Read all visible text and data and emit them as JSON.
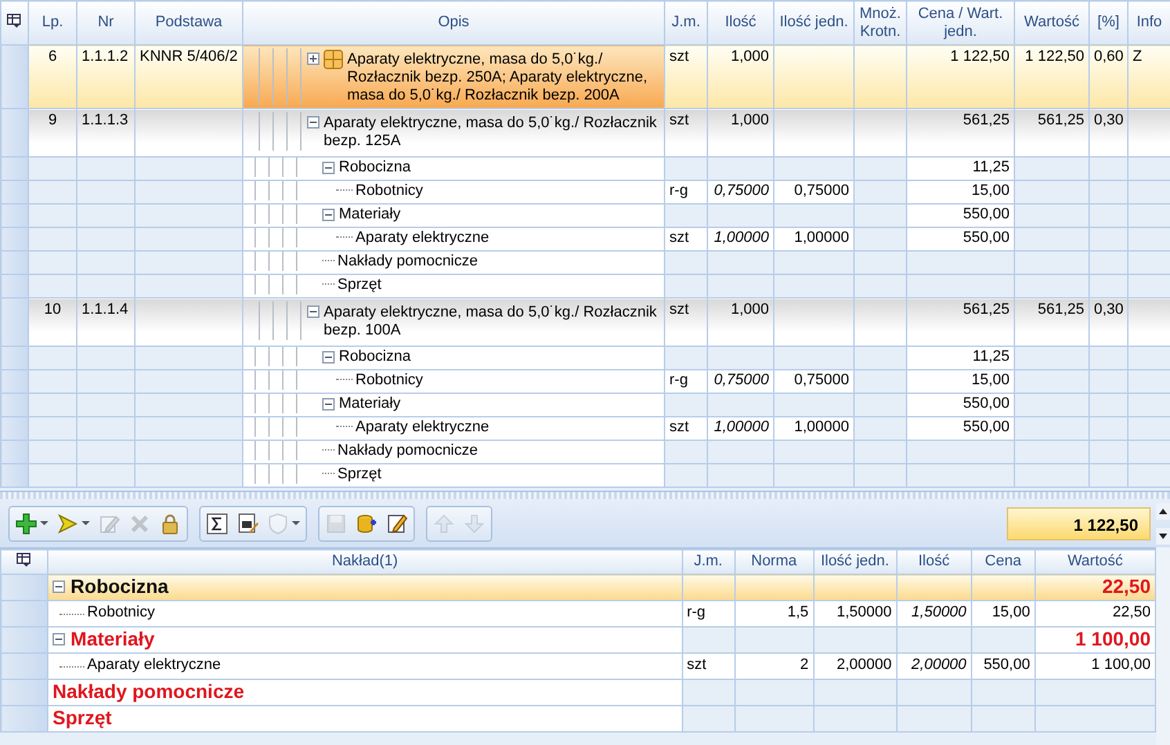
{
  "grid": {
    "columns": [
      "Lp.",
      "Nr",
      "Podstawa",
      "Opis",
      "J.m.",
      "Ilość",
      "Ilość jedn.",
      "Mnoż. Krotn.",
      "Cena / Wart. jedn.",
      "Wartość",
      "[%]",
      "Info"
    ],
    "rows": [
      {
        "kind": "position",
        "lp": "6",
        "nr": "1.1.1.2",
        "podstawa": "KNNR 5/406/2",
        "opis": "Aparaty elektryczne, masa do 5,0˙kg./ Rozłacznik bezp. 250A; Aparaty elektryczne, masa do 5,0˙kg./ Rozłacznik bezp. 200A",
        "jm": "szt",
        "ilosc": "1,000",
        "cena": "1 122,50",
        "wartosc": "1 122,50",
        "procent": "0,60",
        "info": "Z",
        "selected": true,
        "expanded": false,
        "grouped": true
      },
      {
        "kind": "position",
        "lp": "9",
        "nr": "1.1.1.3",
        "opis": "Aparaty elektryczne, masa do 5,0˙kg./ Rozłacznik bezp. 125A",
        "jm": "szt",
        "ilosc": "1,000",
        "cena": "561,25",
        "wartosc": "561,25",
        "procent": "0,30",
        "selected": false,
        "expanded": true,
        "grouped": false,
        "children": [
          {
            "kind": "group",
            "opis": "Robocizna",
            "cena": "11,25",
            "expanded": true,
            "children": [
              {
                "kind": "resource",
                "opis": "Robotnicy",
                "jm": "r-g",
                "ilosc": "0,75000",
                "ilosc_jedn": "0,75000",
                "cena": "15,00"
              }
            ]
          },
          {
            "kind": "group",
            "opis": "Materiały",
            "cena": "550,00",
            "expanded": true,
            "children": [
              {
                "kind": "resource",
                "opis": "Aparaty elektryczne",
                "jm": "szt",
                "ilosc": "1,00000",
                "ilosc_jedn": "1,00000",
                "cena": "550,00"
              }
            ]
          },
          {
            "kind": "empty-group",
            "opis": "Nakłady pomocnicze"
          },
          {
            "kind": "empty-group",
            "opis": "Sprzęt"
          }
        ]
      },
      {
        "kind": "position",
        "lp": "10",
        "nr": "1.1.1.4",
        "opis": "Aparaty elektryczne, masa do 5,0˙kg./ Rozłacznik bezp. 100A",
        "jm": "szt",
        "ilosc": "1,000",
        "cena": "561,25",
        "wartosc": "561,25",
        "procent": "0,30",
        "selected": false,
        "expanded": true,
        "grouped": false,
        "children": [
          {
            "kind": "group",
            "opis": "Robocizna",
            "cena": "11,25",
            "expanded": true,
            "children": [
              {
                "kind": "resource",
                "opis": "Robotnicy",
                "jm": "r-g",
                "ilosc": "0,75000",
                "ilosc_jedn": "0,75000",
                "cena": "15,00"
              }
            ]
          },
          {
            "kind": "group",
            "opis": "Materiały",
            "cena": "550,00",
            "expanded": true,
            "children": [
              {
                "kind": "resource",
                "opis": "Aparaty elektryczne",
                "jm": "szt",
                "ilosc": "1,00000",
                "ilosc_jedn": "1,00000",
                "cena": "550,00"
              }
            ]
          },
          {
            "kind": "empty-group",
            "opis": "Nakłady pomocnicze"
          },
          {
            "kind": "empty-group",
            "opis": "Sprzęt"
          }
        ]
      }
    ]
  },
  "toolbar": {
    "groups": [
      [
        {
          "dropdown": true,
          "disabled": false
        },
        {
          "dropdown": true,
          "disabled": false
        },
        {
          "dropdown": false,
          "disabled": true
        },
        {
          "dropdown": false,
          "disabled": true
        },
        {
          "dropdown": false,
          "disabled": false
        }
      ],
      [
        {
          "dropdown": false,
          "disabled": false
        },
        {
          "dropdown": false,
          "disabled": false
        },
        {
          "dropdown": true,
          "disabled": true
        }
      ],
      [
        {
          "dropdown": false,
          "disabled": true
        },
        {
          "dropdown": false,
          "disabled": false
        },
        {
          "dropdown": false,
          "disabled": false
        }
      ],
      [
        {
          "dropdown": false,
          "disabled": true
        },
        {
          "dropdown": false,
          "disabled": true
        }
      ]
    ],
    "total": "1 122,50"
  },
  "resources": {
    "columns": [
      "Nakład(1)",
      "J.m.",
      "Norma",
      "Ilość jedn.",
      "Ilość",
      "Cena",
      "Wartość"
    ],
    "rows": [
      {
        "kind": "group",
        "naklad": "Robocizna",
        "wartosc": "22,50",
        "selected": true,
        "expanded": true,
        "children": [
          {
            "kind": "resource",
            "naklad": "Robotnicy",
            "jm": "r-g",
            "norma": "1,5",
            "ilosc_jedn": "1,50000",
            "ilosc": "1,50000",
            "cena": "15,00",
            "wartosc": "22,50"
          }
        ]
      },
      {
        "kind": "group",
        "naklad": "Materiały",
        "wartosc": "1 100,00",
        "selected": false,
        "expanded": true,
        "children": [
          {
            "kind": "resource",
            "naklad": "Aparaty elektryczne",
            "jm": "szt",
            "norma": "2",
            "ilosc_jedn": "2,00000",
            "ilosc": "2,00000",
            "cena": "550,00",
            "wartosc": "1 100,00"
          }
        ]
      },
      {
        "kind": "empty-group",
        "naklad": "Nakłady pomocnicze",
        "selected": false
      },
      {
        "kind": "empty-group",
        "naklad": "Sprzęt",
        "selected": false
      }
    ]
  }
}
